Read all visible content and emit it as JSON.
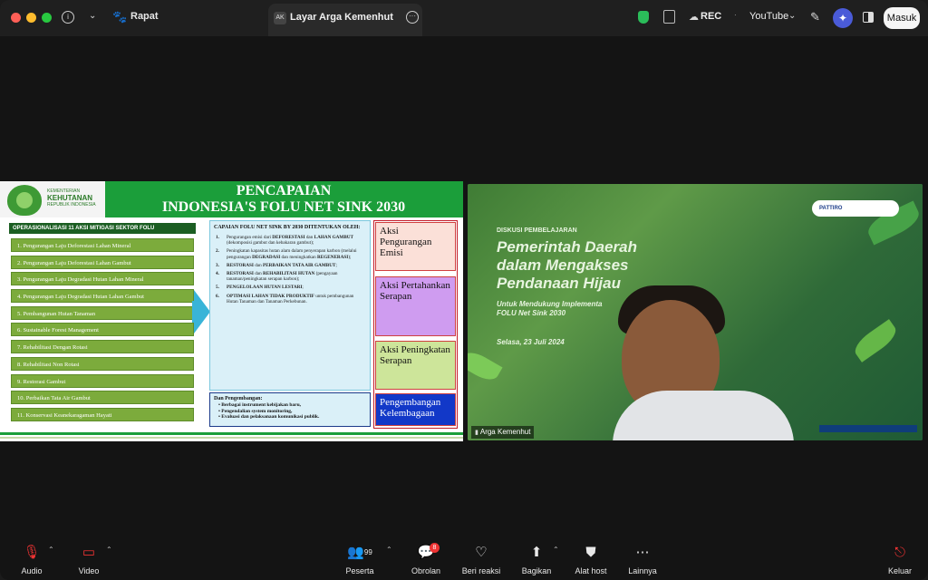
{
  "header": {
    "meeting_name": "Rapat",
    "share_tab_badge": "AK",
    "share_tab_label": "Layar Arga Kemenhut",
    "rec_label": "REC",
    "stream_label": "YouTube",
    "signin_label": "Masuk"
  },
  "slide": {
    "logo_small": "KEMENTERIAN",
    "logo_big": "KEHUTANAN",
    "logo_sub": "REPUBLIK INDONESIA",
    "title_line1": "PENCAPAIAN",
    "title_line2": "INDONESIA'S FOLU NET SINK 2030",
    "left_heading": "OPERASIONALISASI 11 AKSI MITIGASI SEKTOR FOLU",
    "actions": [
      "1. Pengurangan Laju Deforestasi Lahan Mineral",
      "2. Pengurangan Laju Deforestasi Lahan Gambut",
      "3. Pengurangan Laju Degradasi Hutan Lahan Mineral",
      "4. Pengurangan Laju Degradasi Hutan Lahan Gambut",
      "5. Pembangunan Hutan Tanaman",
      "6. Sustainable Forest Management",
      "7. Rehabilitasi Dengan Rotasi",
      "8. Rehabilitasi Non Rotasi",
      "9. Restorasi Gambut",
      "10. Perbaikan Tata Air Gambut",
      "11. Konservasi Keanekaragaman Hayati"
    ],
    "mid_heading": "CAPAIAN FOLU NET SINK BY 2030 DITENTUKAN OLEH:",
    "points": [
      {
        "n": "1.",
        "a": "Pengurangan emisi dari ",
        "b": "DEFORESTASI",
        "c": " dan ",
        "d": "LAHAN GAMBUT",
        "e": " (dekomposisi gambut dan kebakaran gambut);"
      },
      {
        "n": "2.",
        "a": "Peningkatan kapasitas hutan alam dalam penyerapan karbon (melalui pengurangan ",
        "b": "DEGRADASI",
        "c": " dan meningkatkan ",
        "d": "REGENERASI",
        "e": ");"
      },
      {
        "n": "3.",
        "a": "",
        "b": "RESTORASI",
        "c": " dan ",
        "d": "PERBAIKAN TATA AIR GAMBUT",
        "e": ";"
      },
      {
        "n": "4.",
        "a": "",
        "b": "RESTORASI",
        "c": " dan ",
        "d": "REHABILITASI HUTAN",
        "e": " (pengayaan tanaman/peningkatan serapan karbon);"
      },
      {
        "n": "5.",
        "a": "",
        "b": "PENGELOLAAN HUTAN LESTARI",
        "c": ";",
        "d": "",
        "e": ""
      },
      {
        "n": "6.",
        "a": "",
        "b": "OPTIMASI LAHAN TIDAK PRODUKTIF",
        "c": " untuk pembangunan Hutan Tanaman dan Tanaman Perkebunan.",
        "d": "",
        "e": ""
      }
    ],
    "dan_heading": "Dan Pengembangan:",
    "dan_items": [
      "• Berbagai instrument kebijakan baru,",
      "• Pengendalian system monitoring,",
      "• Evaluasi dan pelaksanaan komunikasi publik."
    ],
    "right_boxes": [
      {
        "text": "Aksi Pengurangan Emisi",
        "bg": "#fbe0d8",
        "fg": "#111111"
      },
      {
        "text": "Aksi Pertahankan Serapan",
        "bg": "#cf9cf0",
        "fg": "#111111"
      },
      {
        "text": "Aksi Peningkatan Serapan",
        "bg": "#cde59a",
        "fg": "#111111"
      },
      {
        "text": "Pengembangan Kelembagaan",
        "bg": "#1238c8",
        "fg": "#ffffff"
      }
    ]
  },
  "video": {
    "event_label": "DISKUSI PEMBELAJARAN",
    "headline1": "Pemerintah Daerah",
    "headline2": "dalam Mengakses",
    "headline3": "Pendanaan Hijau",
    "subline1": "Untuk Mendukung Implementa",
    "subline2": "FOLU Net Sink 2030",
    "date": "Selasa, 23 Juli 2024",
    "org_logo": "PATTIRO",
    "participant_name": "Arga Kemenhut"
  },
  "toolbar": {
    "audio": "Audio",
    "video": "Video",
    "participants": "Peserta",
    "participants_count": "99",
    "chat": "Obrolan",
    "chat_count": "8",
    "reactions": "Beri reaksi",
    "share": "Bagikan",
    "host_tools": "Alat host",
    "more": "Lainnya",
    "leave": "Keluar"
  },
  "colors": {
    "accent_green": "#1b9e3a",
    "action_green": "#7cab3c",
    "ai_button": "#4a5bd8",
    "leave_red": "#e33333"
  }
}
